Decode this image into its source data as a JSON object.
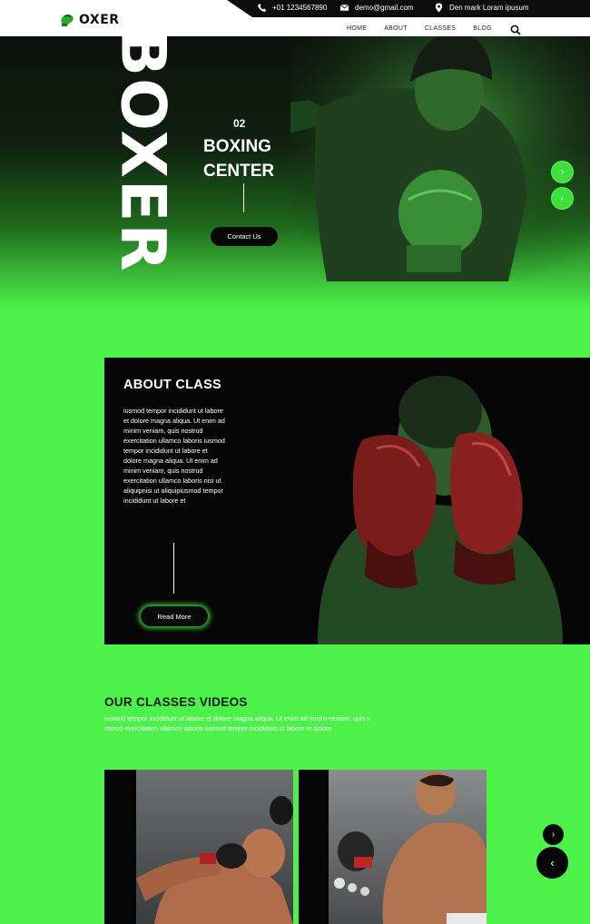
{
  "brand": {
    "name": "OXER",
    "logo_icon": "boxing-glove-icon"
  },
  "topbar": {
    "phone": "+01 1234567890",
    "email": "demo@gmail.com",
    "address": "Den mark Loram ipusum"
  },
  "nav": {
    "items": [
      "HOME",
      "ABOUT",
      "CLASSES",
      "BLOG"
    ],
    "search_icon": "search-icon"
  },
  "hero": {
    "vertical_word": "BOXER",
    "slide_number": "02",
    "title_line1": "BOXING",
    "title_line2": "CENTER",
    "button_label": "Contact Us",
    "next_icon": "chevron-right-icon",
    "prev_icon": "chevron-left-icon"
  },
  "about": {
    "title": "ABOUT CLASS",
    "body": "iusmod tempor incididunt ut labore et dolore magna aliqua. Ut enim ad minim veniam, quis nostrud exercitation ullamco laboris iusmod tempor incididunt ut labore et dolore magna aliqua. Ut enim ad minim veniam, quis nostrud exercitation ullamco laboris nisi ut aliquipnisi ut aliquipiusmod tempor incididunt ut labore et",
    "button_label": "Read More"
  },
  "videos": {
    "title": "OUR CLASSES VIDEOS",
    "description": "iusmod tempor incididunt ut labore et dolore magna aliqua. Ut enim ad minim veniam, quis n ostrud exercitation ullamco laboris iusmod tempor incididunt ut labore et dolore",
    "next_icon": "chevron-right-icon",
    "prev_icon": "chevron-left-icon"
  },
  "colors": {
    "accent_green": "#4cf149",
    "dark": "#060606",
    "white": "#ffffff"
  }
}
